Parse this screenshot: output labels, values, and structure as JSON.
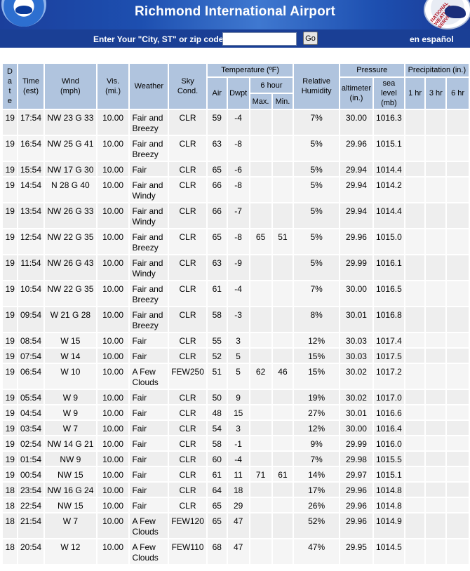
{
  "header": {
    "title": "Richmond International Airport",
    "left_logo": "noaa-logo",
    "right_logo": "nws-logo",
    "right_logo_text": "NATIONAL WEATHER SERVICE"
  },
  "search": {
    "prompt": "Enter Your \"City, ST\" or zip code",
    "value": "",
    "placeholder": "",
    "go_label": "Go",
    "spanish_link": "en español"
  },
  "table": {
    "headers": {
      "date": [
        "D",
        "a",
        "t",
        "e"
      ],
      "time": [
        "Time",
        "(est)"
      ],
      "wind": [
        "Wind",
        "(mph)"
      ],
      "vis": [
        "Vis.",
        "(mi.)"
      ],
      "weather": "Weather",
      "sky": [
        "Sky",
        "Cond."
      ],
      "temperature": "Temperature (ºF)",
      "air": "Air",
      "dwpt": "Dwpt",
      "six_hour": "6 hour",
      "max": "Max.",
      "min": "Min.",
      "humidity": [
        "Relative",
        "Humidity"
      ],
      "pressure": "Pressure",
      "altimeter": [
        "altimeter",
        "(in.)"
      ],
      "sealevel": [
        "sea",
        "level",
        "(mb)"
      ],
      "precip": "Precipitation (in.)",
      "p1": "1 hr",
      "p3": "3 hr",
      "p6": "6 hr"
    },
    "rows": [
      {
        "date": "19",
        "time": "17:54",
        "wind": "NW 23 G 33",
        "vis": "10.00",
        "weather": [
          "Fair and",
          "Breezy"
        ],
        "sky": "CLR",
        "air": "59",
        "dwpt": "-4",
        "max": "",
        "min": "",
        "humidity": "7%",
        "altimeter": "30.00",
        "sealevel": "1016.3",
        "p1": "",
        "p3": "",
        "p6": ""
      },
      {
        "date": "19",
        "time": "16:54",
        "wind": "NW 25 G 41",
        "vis": "10.00",
        "weather": [
          "Fair and",
          "Breezy"
        ],
        "sky": "CLR",
        "air": "63",
        "dwpt": "-8",
        "max": "",
        "min": "",
        "humidity": "5%",
        "altimeter": "29.96",
        "sealevel": "1015.1",
        "p1": "",
        "p3": "",
        "p6": ""
      },
      {
        "date": "19",
        "time": "15:54",
        "wind": "NW 17 G 30",
        "vis": "10.00",
        "weather": [
          "Fair"
        ],
        "sky": "CLR",
        "air": "65",
        "dwpt": "-6",
        "max": "",
        "min": "",
        "humidity": "5%",
        "altimeter": "29.94",
        "sealevel": "1014.4",
        "p1": "",
        "p3": "",
        "p6": ""
      },
      {
        "date": "19",
        "time": "14:54",
        "wind": "N 28 G 40",
        "vis": "10.00",
        "weather": [
          "Fair and",
          "Windy"
        ],
        "sky": "CLR",
        "air": "66",
        "dwpt": "-8",
        "max": "",
        "min": "",
        "humidity": "5%",
        "altimeter": "29.94",
        "sealevel": "1014.2",
        "p1": "",
        "p3": "",
        "p6": ""
      },
      {
        "date": "19",
        "time": "13:54",
        "wind": "NW 26 G 33",
        "vis": "10.00",
        "weather": [
          "Fair and",
          "Windy"
        ],
        "sky": "CLR",
        "air": "66",
        "dwpt": "-7",
        "max": "",
        "min": "",
        "humidity": "5%",
        "altimeter": "29.94",
        "sealevel": "1014.4",
        "p1": "",
        "p3": "",
        "p6": ""
      },
      {
        "date": "19",
        "time": "12:54",
        "wind": "NW 22 G 35",
        "vis": "10.00",
        "weather": [
          "Fair and",
          "Breezy"
        ],
        "sky": "CLR",
        "air": "65",
        "dwpt": "-8",
        "max": "65",
        "min": "51",
        "humidity": "5%",
        "altimeter": "29.96",
        "sealevel": "1015.0",
        "p1": "",
        "p3": "",
        "p6": ""
      },
      {
        "date": "19",
        "time": "11:54",
        "wind": "NW 26 G 43",
        "vis": "10.00",
        "weather": [
          "Fair and",
          "Windy"
        ],
        "sky": "CLR",
        "air": "63",
        "dwpt": "-9",
        "max": "",
        "min": "",
        "humidity": "5%",
        "altimeter": "29.99",
        "sealevel": "1016.1",
        "p1": "",
        "p3": "",
        "p6": ""
      },
      {
        "date": "19",
        "time": "10:54",
        "wind": "NW 22 G 35",
        "vis": "10.00",
        "weather": [
          "Fair and",
          "Breezy"
        ],
        "sky": "CLR",
        "air": "61",
        "dwpt": "-4",
        "max": "",
        "min": "",
        "humidity": "7%",
        "altimeter": "30.00",
        "sealevel": "1016.5",
        "p1": "",
        "p3": "",
        "p6": ""
      },
      {
        "date": "19",
        "time": "09:54",
        "wind": "W 21 G 28",
        "vis": "10.00",
        "weather": [
          "Fair and",
          "Breezy"
        ],
        "sky": "CLR",
        "air": "58",
        "dwpt": "-3",
        "max": "",
        "min": "",
        "humidity": "8%",
        "altimeter": "30.01",
        "sealevel": "1016.8",
        "p1": "",
        "p3": "",
        "p6": ""
      },
      {
        "date": "19",
        "time": "08:54",
        "wind": "W 15",
        "vis": "10.00",
        "weather": [
          "Fair"
        ],
        "sky": "CLR",
        "air": "55",
        "dwpt": "3",
        "max": "",
        "min": "",
        "humidity": "12%",
        "altimeter": "30.03",
        "sealevel": "1017.4",
        "p1": "",
        "p3": "",
        "p6": ""
      },
      {
        "date": "19",
        "time": "07:54",
        "wind": "W 14",
        "vis": "10.00",
        "weather": [
          "Fair"
        ],
        "sky": "CLR",
        "air": "52",
        "dwpt": "5",
        "max": "",
        "min": "",
        "humidity": "15%",
        "altimeter": "30.03",
        "sealevel": "1017.5",
        "p1": "",
        "p3": "",
        "p6": ""
      },
      {
        "date": "19",
        "time": "06:54",
        "wind": "W 10",
        "vis": "10.00",
        "weather": [
          "A Few",
          "Clouds"
        ],
        "sky": "FEW250",
        "air": "51",
        "dwpt": "5",
        "max": "62",
        "min": "46",
        "humidity": "15%",
        "altimeter": "30.02",
        "sealevel": "1017.2",
        "p1": "",
        "p3": "",
        "p6": ""
      },
      {
        "date": "19",
        "time": "05:54",
        "wind": "W 9",
        "vis": "10.00",
        "weather": [
          "Fair"
        ],
        "sky": "CLR",
        "air": "50",
        "dwpt": "9",
        "max": "",
        "min": "",
        "humidity": "19%",
        "altimeter": "30.02",
        "sealevel": "1017.0",
        "p1": "",
        "p3": "",
        "p6": ""
      },
      {
        "date": "19",
        "time": "04:54",
        "wind": "W 9",
        "vis": "10.00",
        "weather": [
          "Fair"
        ],
        "sky": "CLR",
        "air": "48",
        "dwpt": "15",
        "max": "",
        "min": "",
        "humidity": "27%",
        "altimeter": "30.01",
        "sealevel": "1016.6",
        "p1": "",
        "p3": "",
        "p6": ""
      },
      {
        "date": "19",
        "time": "03:54",
        "wind": "W 7",
        "vis": "10.00",
        "weather": [
          "Fair"
        ],
        "sky": "CLR",
        "air": "54",
        "dwpt": "3",
        "max": "",
        "min": "",
        "humidity": "12%",
        "altimeter": "30.00",
        "sealevel": "1016.4",
        "p1": "",
        "p3": "",
        "p6": ""
      },
      {
        "date": "19",
        "time": "02:54",
        "wind": "NW 14 G 21",
        "vis": "10.00",
        "weather": [
          "Fair"
        ],
        "sky": "CLR",
        "air": "58",
        "dwpt": "-1",
        "max": "",
        "min": "",
        "humidity": "9%",
        "altimeter": "29.99",
        "sealevel": "1016.0",
        "p1": "",
        "p3": "",
        "p6": ""
      },
      {
        "date": "19",
        "time": "01:54",
        "wind": "NW 9",
        "vis": "10.00",
        "weather": [
          "Fair"
        ],
        "sky": "CLR",
        "air": "60",
        "dwpt": "-4",
        "max": "",
        "min": "",
        "humidity": "7%",
        "altimeter": "29.98",
        "sealevel": "1015.5",
        "p1": "",
        "p3": "",
        "p6": ""
      },
      {
        "date": "19",
        "time": "00:54",
        "wind": "NW 15",
        "vis": "10.00",
        "weather": [
          "Fair"
        ],
        "sky": "CLR",
        "air": "61",
        "dwpt": "11",
        "max": "71",
        "min": "61",
        "humidity": "14%",
        "altimeter": "29.97",
        "sealevel": "1015.1",
        "p1": "",
        "p3": "",
        "p6": ""
      },
      {
        "date": "18",
        "time": "23:54",
        "wind": "NW 16 G 24",
        "vis": "10.00",
        "weather": [
          "Fair"
        ],
        "sky": "CLR",
        "air": "64",
        "dwpt": "18",
        "max": "",
        "min": "",
        "humidity": "17%",
        "altimeter": "29.96",
        "sealevel": "1014.8",
        "p1": "",
        "p3": "",
        "p6": ""
      },
      {
        "date": "18",
        "time": "22:54",
        "wind": "NW 15",
        "vis": "10.00",
        "weather": [
          "Fair"
        ],
        "sky": "CLR",
        "air": "65",
        "dwpt": "29",
        "max": "",
        "min": "",
        "humidity": "26%",
        "altimeter": "29.96",
        "sealevel": "1014.8",
        "p1": "",
        "p3": "",
        "p6": ""
      },
      {
        "date": "18",
        "time": "21:54",
        "wind": "W 7",
        "vis": "10.00",
        "weather": [
          "A Few",
          "Clouds"
        ],
        "sky": "FEW120",
        "air": "65",
        "dwpt": "47",
        "max": "",
        "min": "",
        "humidity": "52%",
        "altimeter": "29.96",
        "sealevel": "1014.9",
        "p1": "",
        "p3": "",
        "p6": ""
      },
      {
        "date": "18",
        "time": "20:54",
        "wind": "W 12",
        "vis": "10.00",
        "weather": [
          "A Few",
          "Clouds"
        ],
        "sky": "FEW110",
        "air": "68",
        "dwpt": "47",
        "max": "",
        "min": "",
        "humidity": "47%",
        "altimeter": "29.95",
        "sealevel": "1014.5",
        "p1": "",
        "p3": "",
        "p6": ""
      }
    ]
  },
  "colors": {
    "banner": "#1d4fb0",
    "searchbar": "#1a3f95",
    "header_cell": "#b0c4de",
    "row_a": "#eeeeee",
    "row_b": "#f5f5f5"
  }
}
